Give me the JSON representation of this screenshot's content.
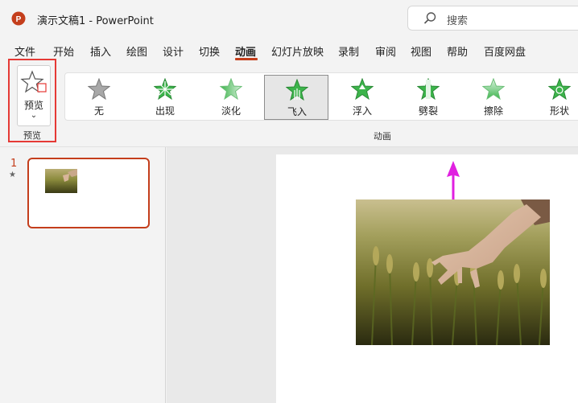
{
  "app": {
    "title": "演示文稿1  -  PowerPoint",
    "logo_letter": "P"
  },
  "search": {
    "placeholder": "搜索"
  },
  "menu": [
    {
      "label": "文件"
    },
    {
      "label": "开始"
    },
    {
      "label": "插入"
    },
    {
      "label": "绘图"
    },
    {
      "label": "设计"
    },
    {
      "label": "切换"
    },
    {
      "label": "动画",
      "active": true
    },
    {
      "label": "幻灯片放映"
    },
    {
      "label": "录制"
    },
    {
      "label": "审阅"
    },
    {
      "label": "视图"
    },
    {
      "label": "帮助"
    },
    {
      "label": "百度网盘"
    }
  ],
  "ribbon": {
    "preview": {
      "label": "预览",
      "chevron": "⌄",
      "group_label": "预览"
    },
    "animations_group_label": "动画",
    "animations": [
      {
        "label": "无",
        "icon": "star-none-icon"
      },
      {
        "label": "出现",
        "icon": "star-appear-icon"
      },
      {
        "label": "淡化",
        "icon": "star-fade-icon"
      },
      {
        "label": "飞入",
        "icon": "star-fly-in-icon",
        "selected": true
      },
      {
        "label": "浮入",
        "icon": "star-float-in-icon"
      },
      {
        "label": "劈裂",
        "icon": "star-split-icon"
      },
      {
        "label": "擦除",
        "icon": "star-wipe-icon"
      },
      {
        "label": "形状",
        "icon": "star-shape-icon"
      }
    ]
  },
  "slides_panel": {
    "slide_number": "1",
    "animation_marker": "★"
  },
  "colors": {
    "accent": "#c43e1c",
    "highlight_border": "#e53935",
    "motion_path": "#e020e0",
    "anim_star": "#3cb44b"
  }
}
